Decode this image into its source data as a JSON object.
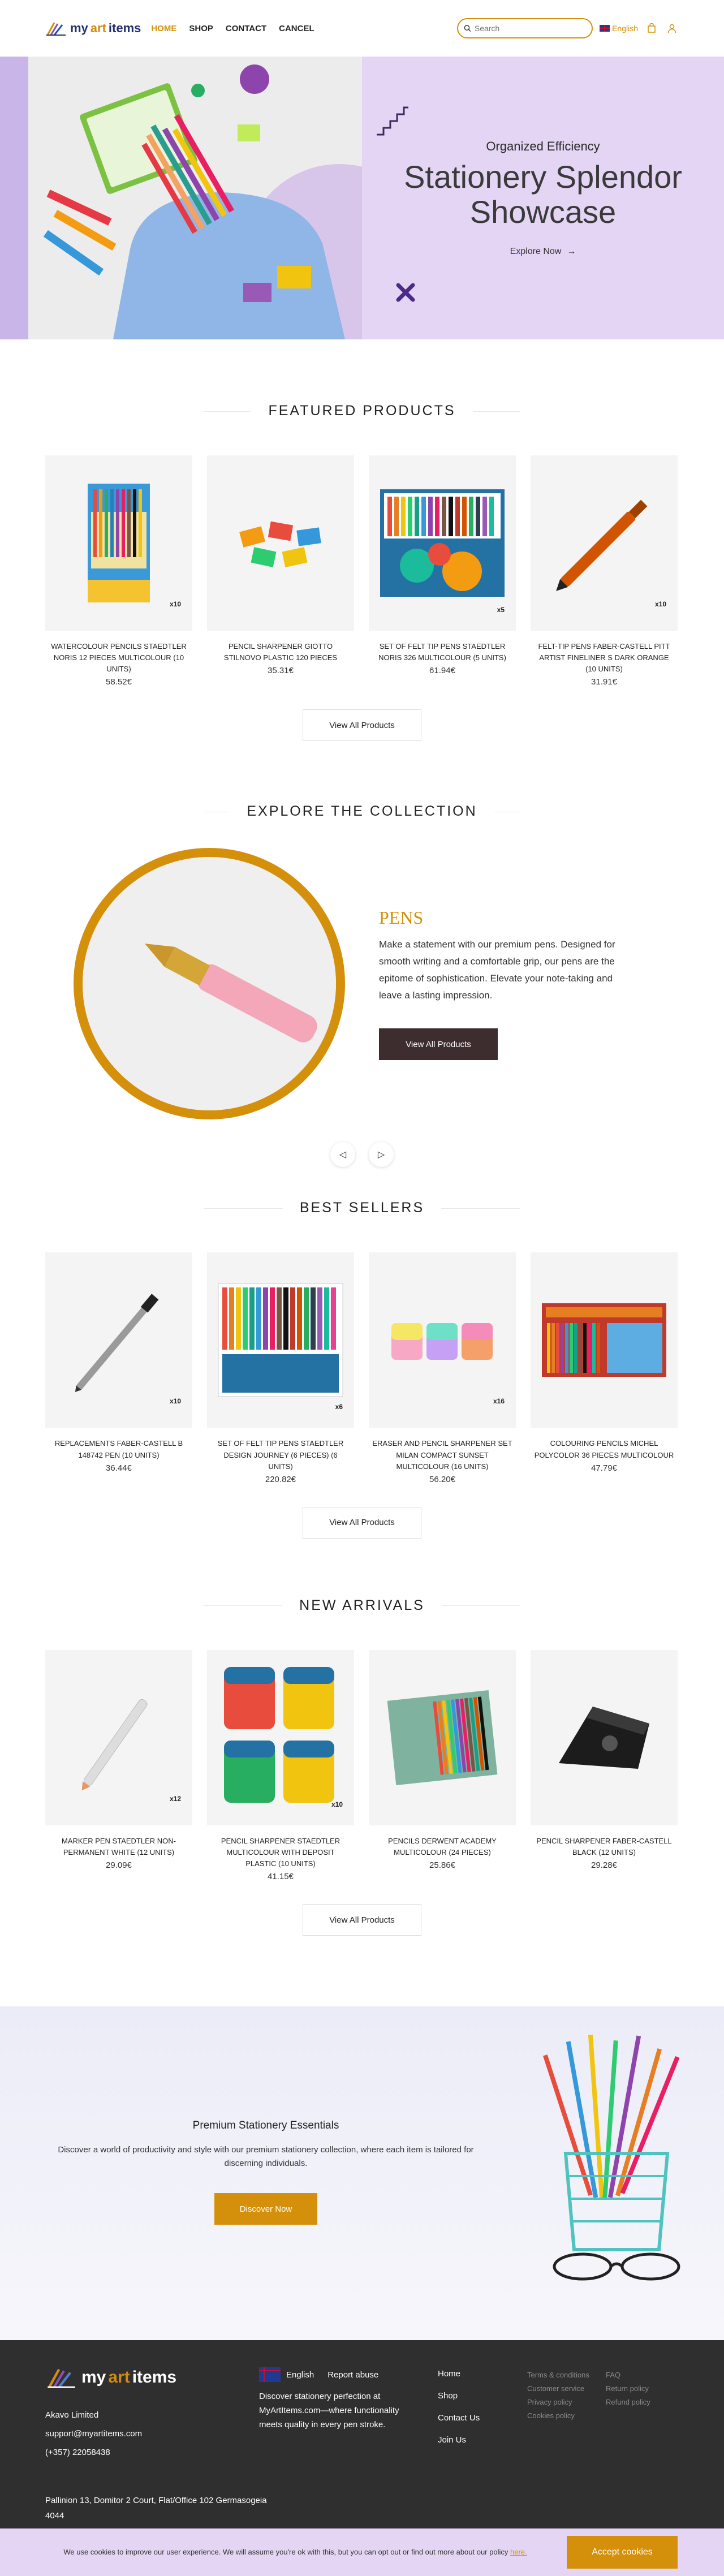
{
  "header": {
    "logo": {
      "my": "my",
      "art": "art",
      "items": "items"
    },
    "nav": [
      {
        "label": "HOME"
      },
      {
        "label": "SHOP"
      },
      {
        "label": "CONTACT"
      },
      {
        "label": "CANCEL"
      }
    ],
    "search_placeholder": "Search",
    "language": "English"
  },
  "hero": {
    "subtitle": "Organized Efficiency",
    "title_line1": "Stationery Splendor",
    "title_line2": "Showcase",
    "cta": "Explore Now"
  },
  "featured": {
    "title": "FEATURED PRODUCTS",
    "products": [
      {
        "name": "WATERCOLOUR PENCILS STAEDTLER NORIS 12 PIECES MULTICOLOUR (10 UNITS)",
        "price": "58.52€",
        "qty": "x10"
      },
      {
        "name": "PENCIL SHARPENER GIOTTO STILNOVO PLASTIC 120 PIECES",
        "price": "35.31€",
        "qty": ""
      },
      {
        "name": "SET OF FELT TIP PENS STAEDTLER NORIS 326 MULTICOLOUR (5 UNITS)",
        "price": "61.94€",
        "qty": "x5"
      },
      {
        "name": "FELT-TIP PENS FABER-CASTELL PITT ARTIST FINELINER S DARK ORANGE (10 UNITS)",
        "price": "31.91€",
        "qty": "x10"
      }
    ],
    "view_all": "View All Products"
  },
  "collection": {
    "section_title": "EXPLORE THE COLLECTION",
    "title": "PENS",
    "description": "Make a statement with our premium pens. Designed for smooth writing and a comfortable grip, our pens are the epitome of sophistication. Elevate your note-taking and leave a lasting impression.",
    "button": "View All Products"
  },
  "bestsellers": {
    "title": "BEST SELLERS",
    "products": [
      {
        "name": "REPLACEMENTS FABER-CASTELL B 148742 PEN (10 UNITS)",
        "price": "36.44€",
        "qty": "x10"
      },
      {
        "name": "SET OF FELT TIP PENS STAEDTLER DESIGN JOURNEY (6 PIECES) (6 UNITS)",
        "price": "220.82€",
        "qty": "x6"
      },
      {
        "name": "ERASER AND PENCIL SHARPENER SET MILAN COMPACT SUNSET MULTICOLOUR (16 UNITS)",
        "price": "56.20€",
        "qty": "x16"
      },
      {
        "name": "COLOURING PENCILS MICHEL POLYCOLOR 36 PIECES MULTICOLOUR",
        "price": "47.79€",
        "qty": ""
      }
    ],
    "view_all": "View All Products"
  },
  "arrivals": {
    "title": "NEW ARRIVALS",
    "products": [
      {
        "name": "MARKER PEN STAEDTLER NON-PERMANENT WHITE (12 UNITS)",
        "price": "29.09€",
        "qty": "x12"
      },
      {
        "name": "PENCIL SHARPENER STAEDTLER MULTICOLOUR WITH DEPOSIT PLASTIC (10 UNITS)",
        "price": "41.15€",
        "qty": "x10"
      },
      {
        "name": "PENCILS DERWENT ACADEMY MULTICOLOUR (24 PIECES)",
        "price": "25.86€",
        "qty": ""
      },
      {
        "name": "PENCIL SHARPENER FABER-CASTELL BLACK (12 UNITS)",
        "price": "29.28€",
        "qty": ""
      }
    ],
    "view_all": "View All Products"
  },
  "promo": {
    "title": "Premium Stationery Essentials",
    "description": "Discover a world of productivity and style with our premium stationery collection, where each item is tailored for discerning individuals.",
    "button": "Discover Now"
  },
  "footer": {
    "company": "Akavo Limited",
    "email": "support@myartitems.com",
    "phone": "(+357) 22058438",
    "address_line1": "Pallinion 13, Domitor 2 Court, Flat/Office 102 Germasogeia",
    "address_line2": "4044",
    "language": "English",
    "report": "Report abuse",
    "tagline": "Discover stationery perfection at MyArtItems.com—where functionality meets quality in every pen stroke.",
    "links": [
      "Home",
      "Shop",
      "Contact Us",
      "Join Us"
    ],
    "legal": [
      "Terms & conditions",
      "Customer service",
      "Privacy policy",
      "Cookies policy"
    ],
    "help": [
      "FAQ",
      "Return policy",
      "Refund policy"
    ]
  },
  "cookie": {
    "text": "We use cookies to improve our user experience. We will assume you're ok with this, but you can opt out or find out more about our policy",
    "link": "here.",
    "button": "Accept cookies"
  }
}
